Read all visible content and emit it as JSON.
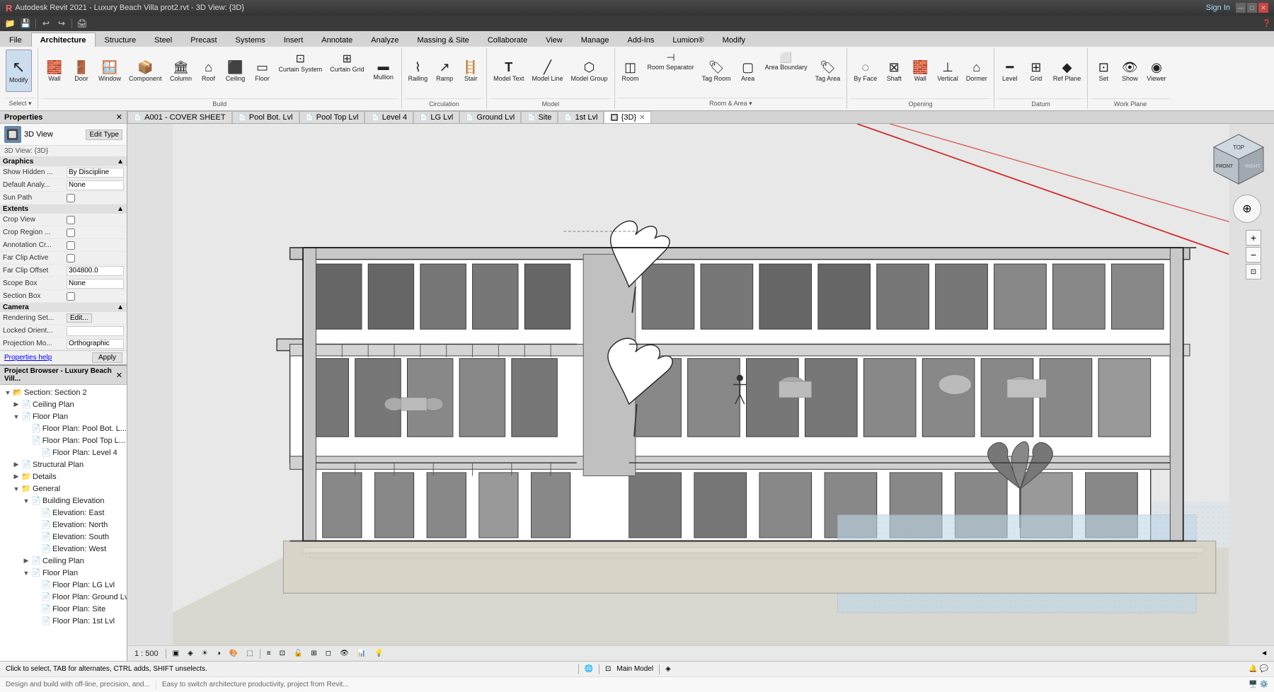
{
  "titlebar": {
    "title": "Autodesk Revit 2021 - Luxury Beach Villa prot2.rvt - 3D View: {3D}",
    "sign_in": "Sign In"
  },
  "qat": {
    "buttons": [
      "📁",
      "💾",
      "↩",
      "↪",
      "🖨"
    ]
  },
  "ribbon": {
    "tabs": [
      "File",
      "Architecture",
      "Structure",
      "Steel",
      "Precast",
      "Systems",
      "Insert",
      "Annotate",
      "Analyze",
      "Massing & Site",
      "Collaborate",
      "View",
      "Manage",
      "Add-Ins",
      "Lumion®",
      "Modify"
    ],
    "active_tab": "Architecture",
    "groups": {
      "select": {
        "label": "Select",
        "tools": [
          {
            "icon": "↖",
            "label": "Modify"
          }
        ]
      },
      "build": {
        "label": "Build",
        "tools": [
          {
            "icon": "🧱",
            "label": "Wall"
          },
          {
            "icon": "🚪",
            "label": "Door"
          },
          {
            "icon": "🪟",
            "label": "Window"
          },
          {
            "icon": "📦",
            "label": "Component"
          },
          {
            "icon": "🏛",
            "label": "Column"
          },
          {
            "icon": "🔲",
            "label": "Roof"
          },
          {
            "icon": "⬛",
            "label": "Ceiling"
          },
          {
            "icon": "▭",
            "label": "Floor"
          },
          {
            "icon": "⊡",
            "label": "Curtain System"
          },
          {
            "icon": "⊞",
            "label": "Curtain Grid"
          },
          {
            "icon": "▬",
            "label": "Mullion"
          }
        ]
      },
      "circulation": {
        "label": "Circulation",
        "tools": [
          {
            "icon": "⌇",
            "label": "Railing"
          },
          {
            "icon": "↗",
            "label": "Ramp"
          },
          {
            "icon": "🪜",
            "label": "Stair"
          }
        ]
      },
      "model": {
        "label": "Model",
        "tools": [
          {
            "icon": "T",
            "label": "Model Text"
          },
          {
            "icon": "╱",
            "label": "Model Line"
          },
          {
            "icon": "⬡",
            "label": "Model Group"
          }
        ]
      },
      "room": {
        "label": "Room & Area",
        "tools": [
          {
            "icon": "◫",
            "label": "Room"
          },
          {
            "icon": "◫",
            "label": "Room Separator"
          },
          {
            "icon": "◧",
            "label": "Tag Room"
          },
          {
            "icon": "▢",
            "label": "Area"
          },
          {
            "icon": "▢",
            "label": "Area Boundary"
          },
          {
            "icon": "◻",
            "label": "Tag Area"
          }
        ]
      },
      "opening": {
        "label": "Opening",
        "tools": [
          {
            "icon": "◌",
            "label": "By Face"
          },
          {
            "icon": "□",
            "label": "Shaft"
          },
          {
            "icon": "🧱",
            "label": "Wall"
          },
          {
            "icon": "⊥",
            "label": "Vertical"
          },
          {
            "icon": "⌂",
            "label": "Dormer"
          }
        ]
      },
      "datum": {
        "label": "Datum",
        "tools": [
          {
            "icon": "—",
            "label": "Level"
          },
          {
            "icon": "⊞",
            "label": "Grid"
          },
          {
            "icon": "◆",
            "label": "Ref Plane"
          }
        ]
      },
      "work_plane": {
        "label": "Work Plane",
        "tools": [
          {
            "icon": "⊡",
            "label": "Set"
          },
          {
            "icon": "👁",
            "label": "Show"
          },
          {
            "icon": "◉",
            "label": "Viewer"
          }
        ]
      }
    }
  },
  "properties": {
    "title": "Properties",
    "close_icon": "✕",
    "view_type": "3D View",
    "edit_type_btn": "Edit Type",
    "view_name": "3D View: {3D}",
    "sections": {
      "graphics": {
        "label": "Graphics",
        "rows": [
          {
            "label": "Show Hidden ...",
            "value": "By Discipline"
          },
          {
            "label": "Default Analy...",
            "value": "None"
          },
          {
            "label": "Sun Path",
            "value": "",
            "type": "checkbox"
          }
        ]
      },
      "extents": {
        "label": "Extents",
        "rows": [
          {
            "label": "Crop View",
            "value": "",
            "type": "checkbox"
          },
          {
            "label": "Crop Region ...",
            "value": "",
            "type": "checkbox"
          },
          {
            "label": "Annotation Cr...",
            "value": "",
            "type": "checkbox"
          },
          {
            "label": "Far Clip Active",
            "value": "",
            "type": "checkbox"
          },
          {
            "label": "Far Clip Offset",
            "value": "304800.0"
          },
          {
            "label": "Scope Box",
            "value": "None"
          },
          {
            "label": "Section Box",
            "value": "",
            "type": "checkbox"
          }
        ]
      },
      "camera": {
        "label": "Camera",
        "rows": [
          {
            "label": "Rendering Set...",
            "value": "Edit..."
          },
          {
            "label": "Locked Orient...",
            "value": ""
          },
          {
            "label": "Projection Mo...",
            "value": "Orthographic"
          }
        ]
      }
    },
    "help_link": "Properties help",
    "apply_btn": "Apply"
  },
  "project_browser": {
    "title": "Project Browser - Luxury Beach Vill...",
    "close_icon": "✕",
    "section_label": "Section: Section 2",
    "tree": [
      {
        "label": "Ceiling Plan",
        "level": 1,
        "expanded": false,
        "icon": "📄"
      },
      {
        "label": "Floor Plan",
        "level": 1,
        "expanded": true,
        "icon": "📄",
        "children": [
          {
            "label": "Floor Plan: Pool Bot. L...",
            "level": 2,
            "icon": "📄"
          },
          {
            "label": "Floor Plan: Pool Top L...",
            "level": 2,
            "icon": "📄"
          },
          {
            "label": "Floor Plan: Level 4",
            "level": 2,
            "icon": "📄"
          }
        ]
      },
      {
        "label": "Structural Plan",
        "level": 1,
        "expanded": false,
        "icon": "📄"
      },
      {
        "label": "Details",
        "level": 1,
        "expanded": false,
        "icon": "📁"
      },
      {
        "label": "General",
        "level": 1,
        "expanded": true,
        "icon": "📁",
        "children": [
          {
            "label": "Building Elevation",
            "level": 2,
            "expanded": true,
            "icon": "📄",
            "children": [
              {
                "label": "Elevation: East",
                "level": 3,
                "icon": "📄"
              },
              {
                "label": "Elevation: North",
                "level": 3,
                "icon": "📄"
              },
              {
                "label": "Elevation: South",
                "level": 3,
                "icon": "📄"
              },
              {
                "label": "Elevation: West",
                "level": 3,
                "icon": "📄"
              }
            ]
          },
          {
            "label": "Ceiling Plan",
            "level": 2,
            "icon": "📄"
          },
          {
            "label": "Floor Plan",
            "level": 2,
            "expanded": true,
            "icon": "📄",
            "children": [
              {
                "label": "Floor Plan: LG Lvl",
                "level": 3,
                "icon": "📄"
              },
              {
                "label": "Floor Plan: Ground Lv...",
                "level": 3,
                "icon": "📄"
              },
              {
                "label": "Floor Plan: Site",
                "level": 3,
                "icon": "📄"
              },
              {
                "label": "Floor Plan: 1st Lvl",
                "level": 3,
                "icon": "📄"
              }
            ]
          }
        ]
      }
    ]
  },
  "tabs": [
    {
      "label": "A001 - COVER SHEET",
      "icon": "📄",
      "closeable": false
    },
    {
      "label": "Pool Bot. Lvl",
      "icon": "📄",
      "closeable": false
    },
    {
      "label": "Pool Top Lvl",
      "icon": "📄",
      "closeable": false
    },
    {
      "label": "Level 4",
      "icon": "📄",
      "closeable": false
    },
    {
      "label": "LG Lvl",
      "icon": "📄",
      "closeable": false
    },
    {
      "label": "Ground Lvl",
      "icon": "📄",
      "closeable": false
    },
    {
      "label": "Site",
      "icon": "📄",
      "closeable": false
    },
    {
      "label": "1st Lvl",
      "icon": "📄",
      "closeable": false
    },
    {
      "label": "{3D}",
      "icon": "🔲",
      "closeable": true,
      "active": true
    }
  ],
  "status_bar": {
    "message": "Click to select, TAB for alternates, CTRL adds, SHIFT unselects.",
    "scale": "1 : 500",
    "model": "Main Model",
    "bottom_msg1": "Design and build with off-line, precision, and...",
    "bottom_msg2": "Easy to switch architecture productivity, project from Revit..."
  },
  "viewport": {
    "view_cube": {
      "top": "TOP",
      "front": "FRONT",
      "right": "RIGHT"
    }
  }
}
